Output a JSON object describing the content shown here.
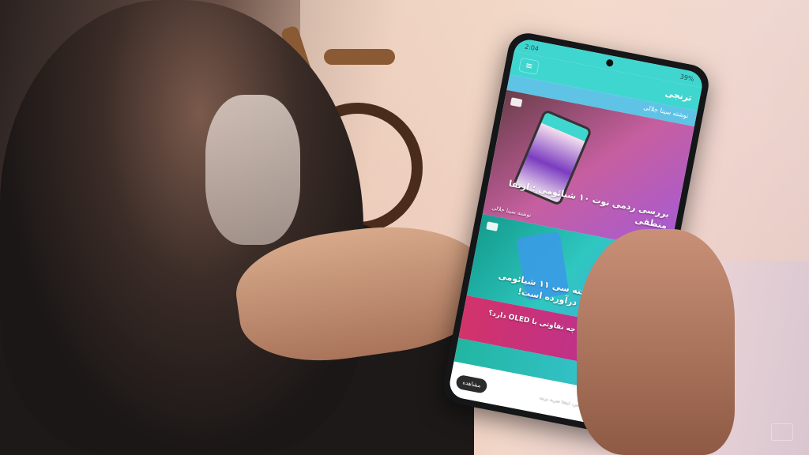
{
  "status_bar": {
    "time": "2:04",
    "battery": "39%"
  },
  "app": {
    "title": "ترنجی",
    "menu_icon": "menu-icon"
  },
  "strip_author": "نوشته سینا جلالی",
  "articles": [
    {
      "title": "بررسی ردمی نوت ۱۰ شیائومی : ارتقا منطقی",
      "author": "نوشته سینا جلالی"
    },
    {
      "title": "مادربردهای سوخته سی ۱۱ شیائومی صدای کاربران را درآورده است!"
    },
    {
      "title": "Mini-LED چیست و چه تفاوتی با OLED دارد؟"
    }
  ],
  "bottom_banner": {
    "button": "مشاهده",
    "text": "برای آشنایی با اپلیکیشن، اینجا ضربه بزنید"
  },
  "colors": {
    "accent": "#3fd6cf"
  }
}
